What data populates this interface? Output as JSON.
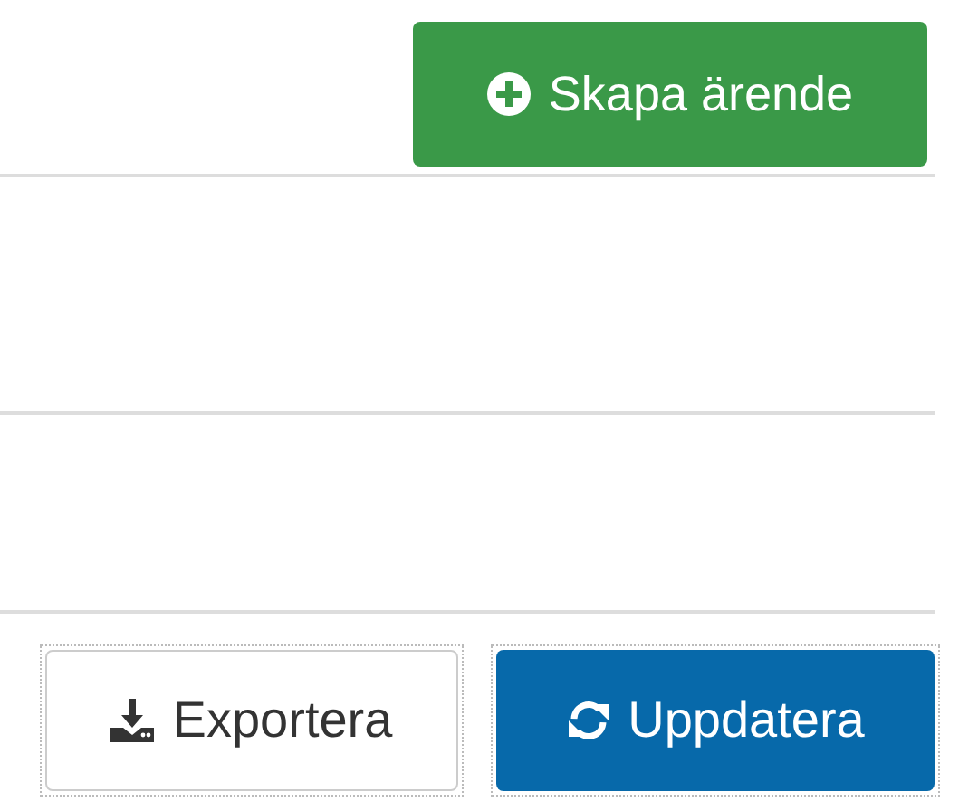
{
  "create_button": {
    "label": "Skapa ärende"
  },
  "actions": [
    {
      "kind": "export",
      "label": "Exportera"
    },
    {
      "kind": "refresh",
      "label": "Uppdatera"
    }
  ]
}
